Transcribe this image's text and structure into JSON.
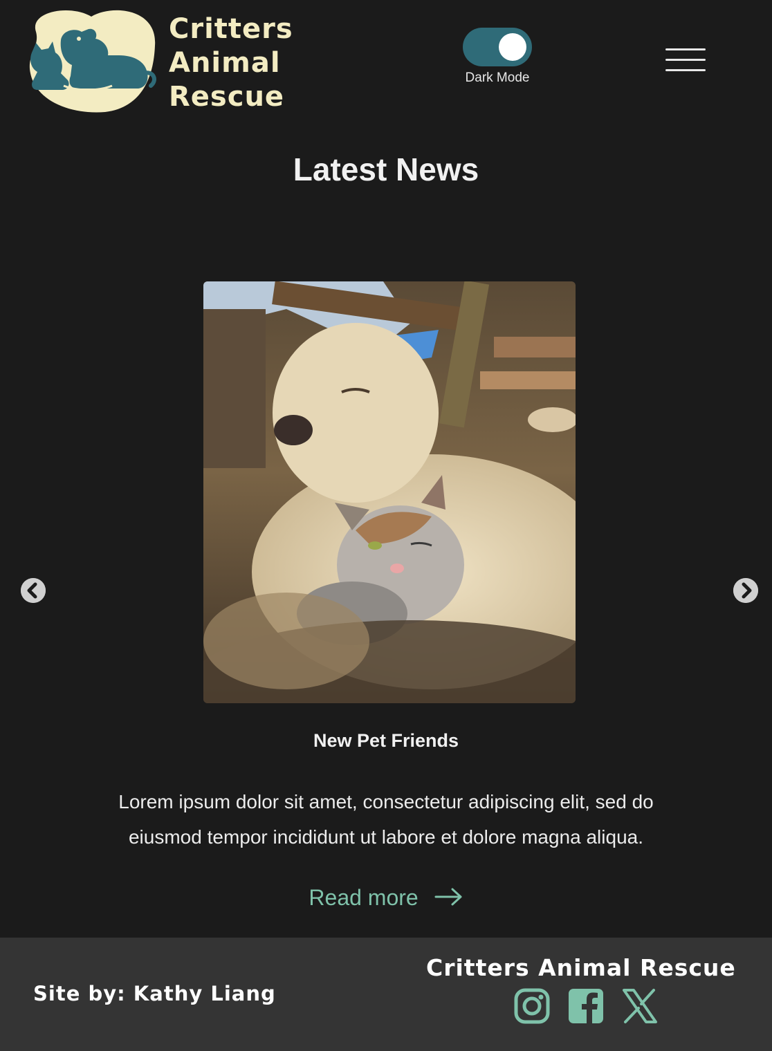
{
  "header": {
    "brand_line1": "Critters",
    "brand_line2": "Animal",
    "brand_line3": "Rescue",
    "dark_mode_label": "Dark Mode",
    "dark_mode_on": true
  },
  "main": {
    "title": "Latest News",
    "article": {
      "title": "New Pet Friends",
      "body": "Lorem ipsum dolor sit amet, consectetur adipiscing elit, sed do eiusmod tempor incididunt ut labore et dolore magna aliqua.",
      "read_more": "Read more"
    }
  },
  "footer": {
    "credit": "Site by: Kathy Liang",
    "brand": "Critters Animal Rescue",
    "social_icons": [
      "instagram-icon",
      "facebook-icon",
      "x-icon"
    ]
  },
  "colors": {
    "background": "#1b1b1b",
    "footer": "#343434",
    "accent": "#7fc2aa",
    "logo_cream": "#f3ecc2",
    "logo_teal": "#2f6b78"
  }
}
